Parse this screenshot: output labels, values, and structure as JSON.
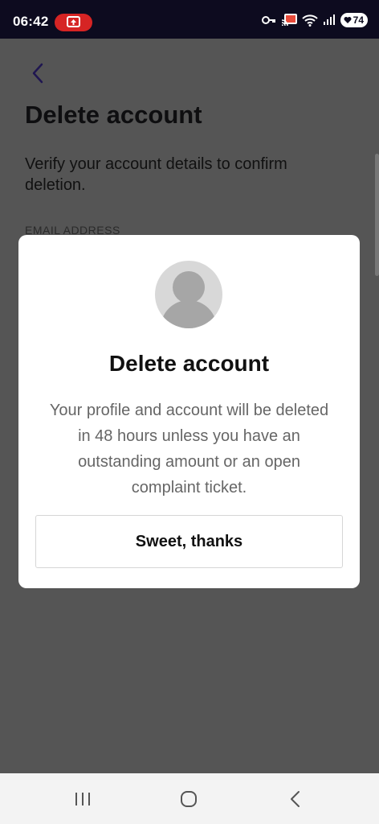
{
  "status_bar": {
    "time": "06:42",
    "battery": "74",
    "icons": [
      "screen-record-icon",
      "key-icon",
      "cast-icon",
      "wifi-icon",
      "signal-icon",
      "battery-icon"
    ]
  },
  "page": {
    "title": "Delete account",
    "subtitle": "Verify your account details to confirm deletion.",
    "email_label": "EMAIL ADDRESS"
  },
  "modal": {
    "title": "Delete account",
    "message": "Your profile and account will be deleted in 48 hours unless you have an outstanding amount or an open complaint ticket.",
    "confirm_label": "Sweet, thanks"
  },
  "nav": {
    "items": [
      "recents",
      "home",
      "back"
    ]
  },
  "colors": {
    "status_bar_bg": "#0d0b1f",
    "record_pill": "#d62424",
    "overlay_bg": "#555555",
    "accent_back_arrow": "#1f1650"
  }
}
